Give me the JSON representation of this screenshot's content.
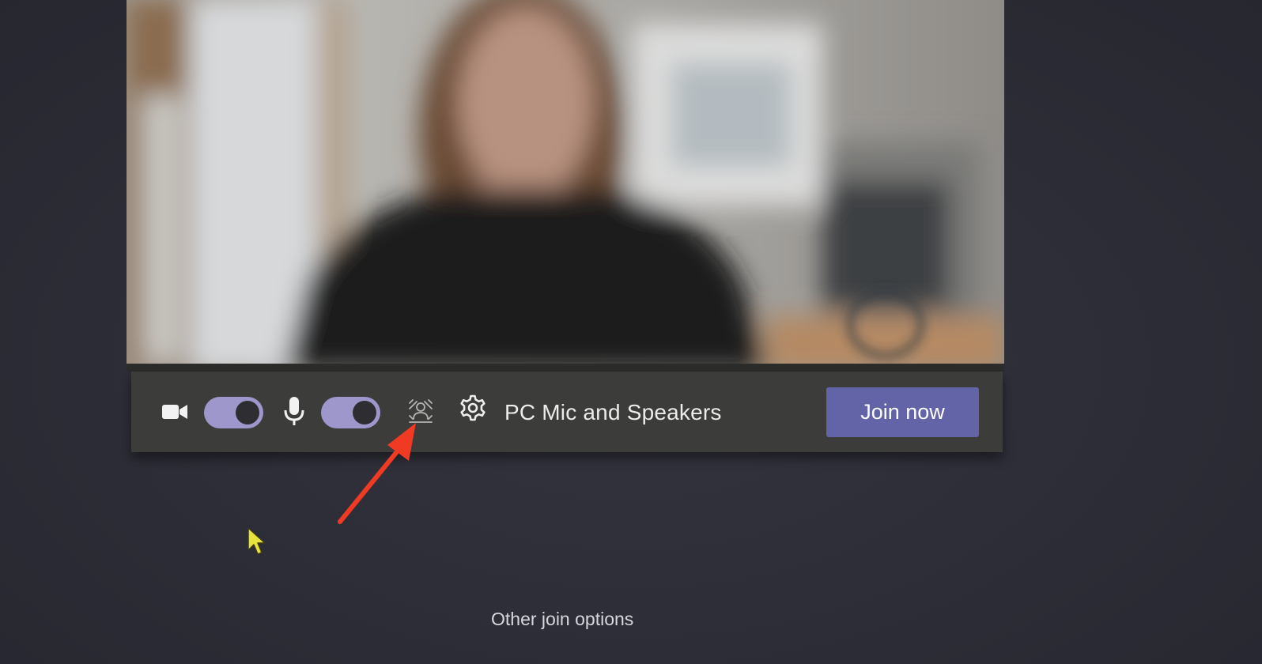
{
  "prejoin": {
    "video_preview": {
      "camera_on": true,
      "background_blurred": true
    },
    "controls": {
      "camera_icon": "video-camera-icon",
      "camera_toggle_on": true,
      "mic_icon": "microphone-icon",
      "mic_toggle_on": true,
      "background_effects_icon": "background-blur-icon",
      "settings_icon": "gear-icon",
      "audio_device_label": "PC Mic and Speakers"
    },
    "join_button_label": "Join now",
    "other_join_options_label": "Other join options"
  },
  "annotation": {
    "arrow_color": "#f03a24",
    "points_to": "background-blur-icon"
  },
  "colors": {
    "page_background": "#2f2f3a",
    "control_bar": "#3c3c3a",
    "toggle_on": "#9d97cc",
    "join_button": "#6264a7",
    "cursor": "#e8e23a"
  }
}
